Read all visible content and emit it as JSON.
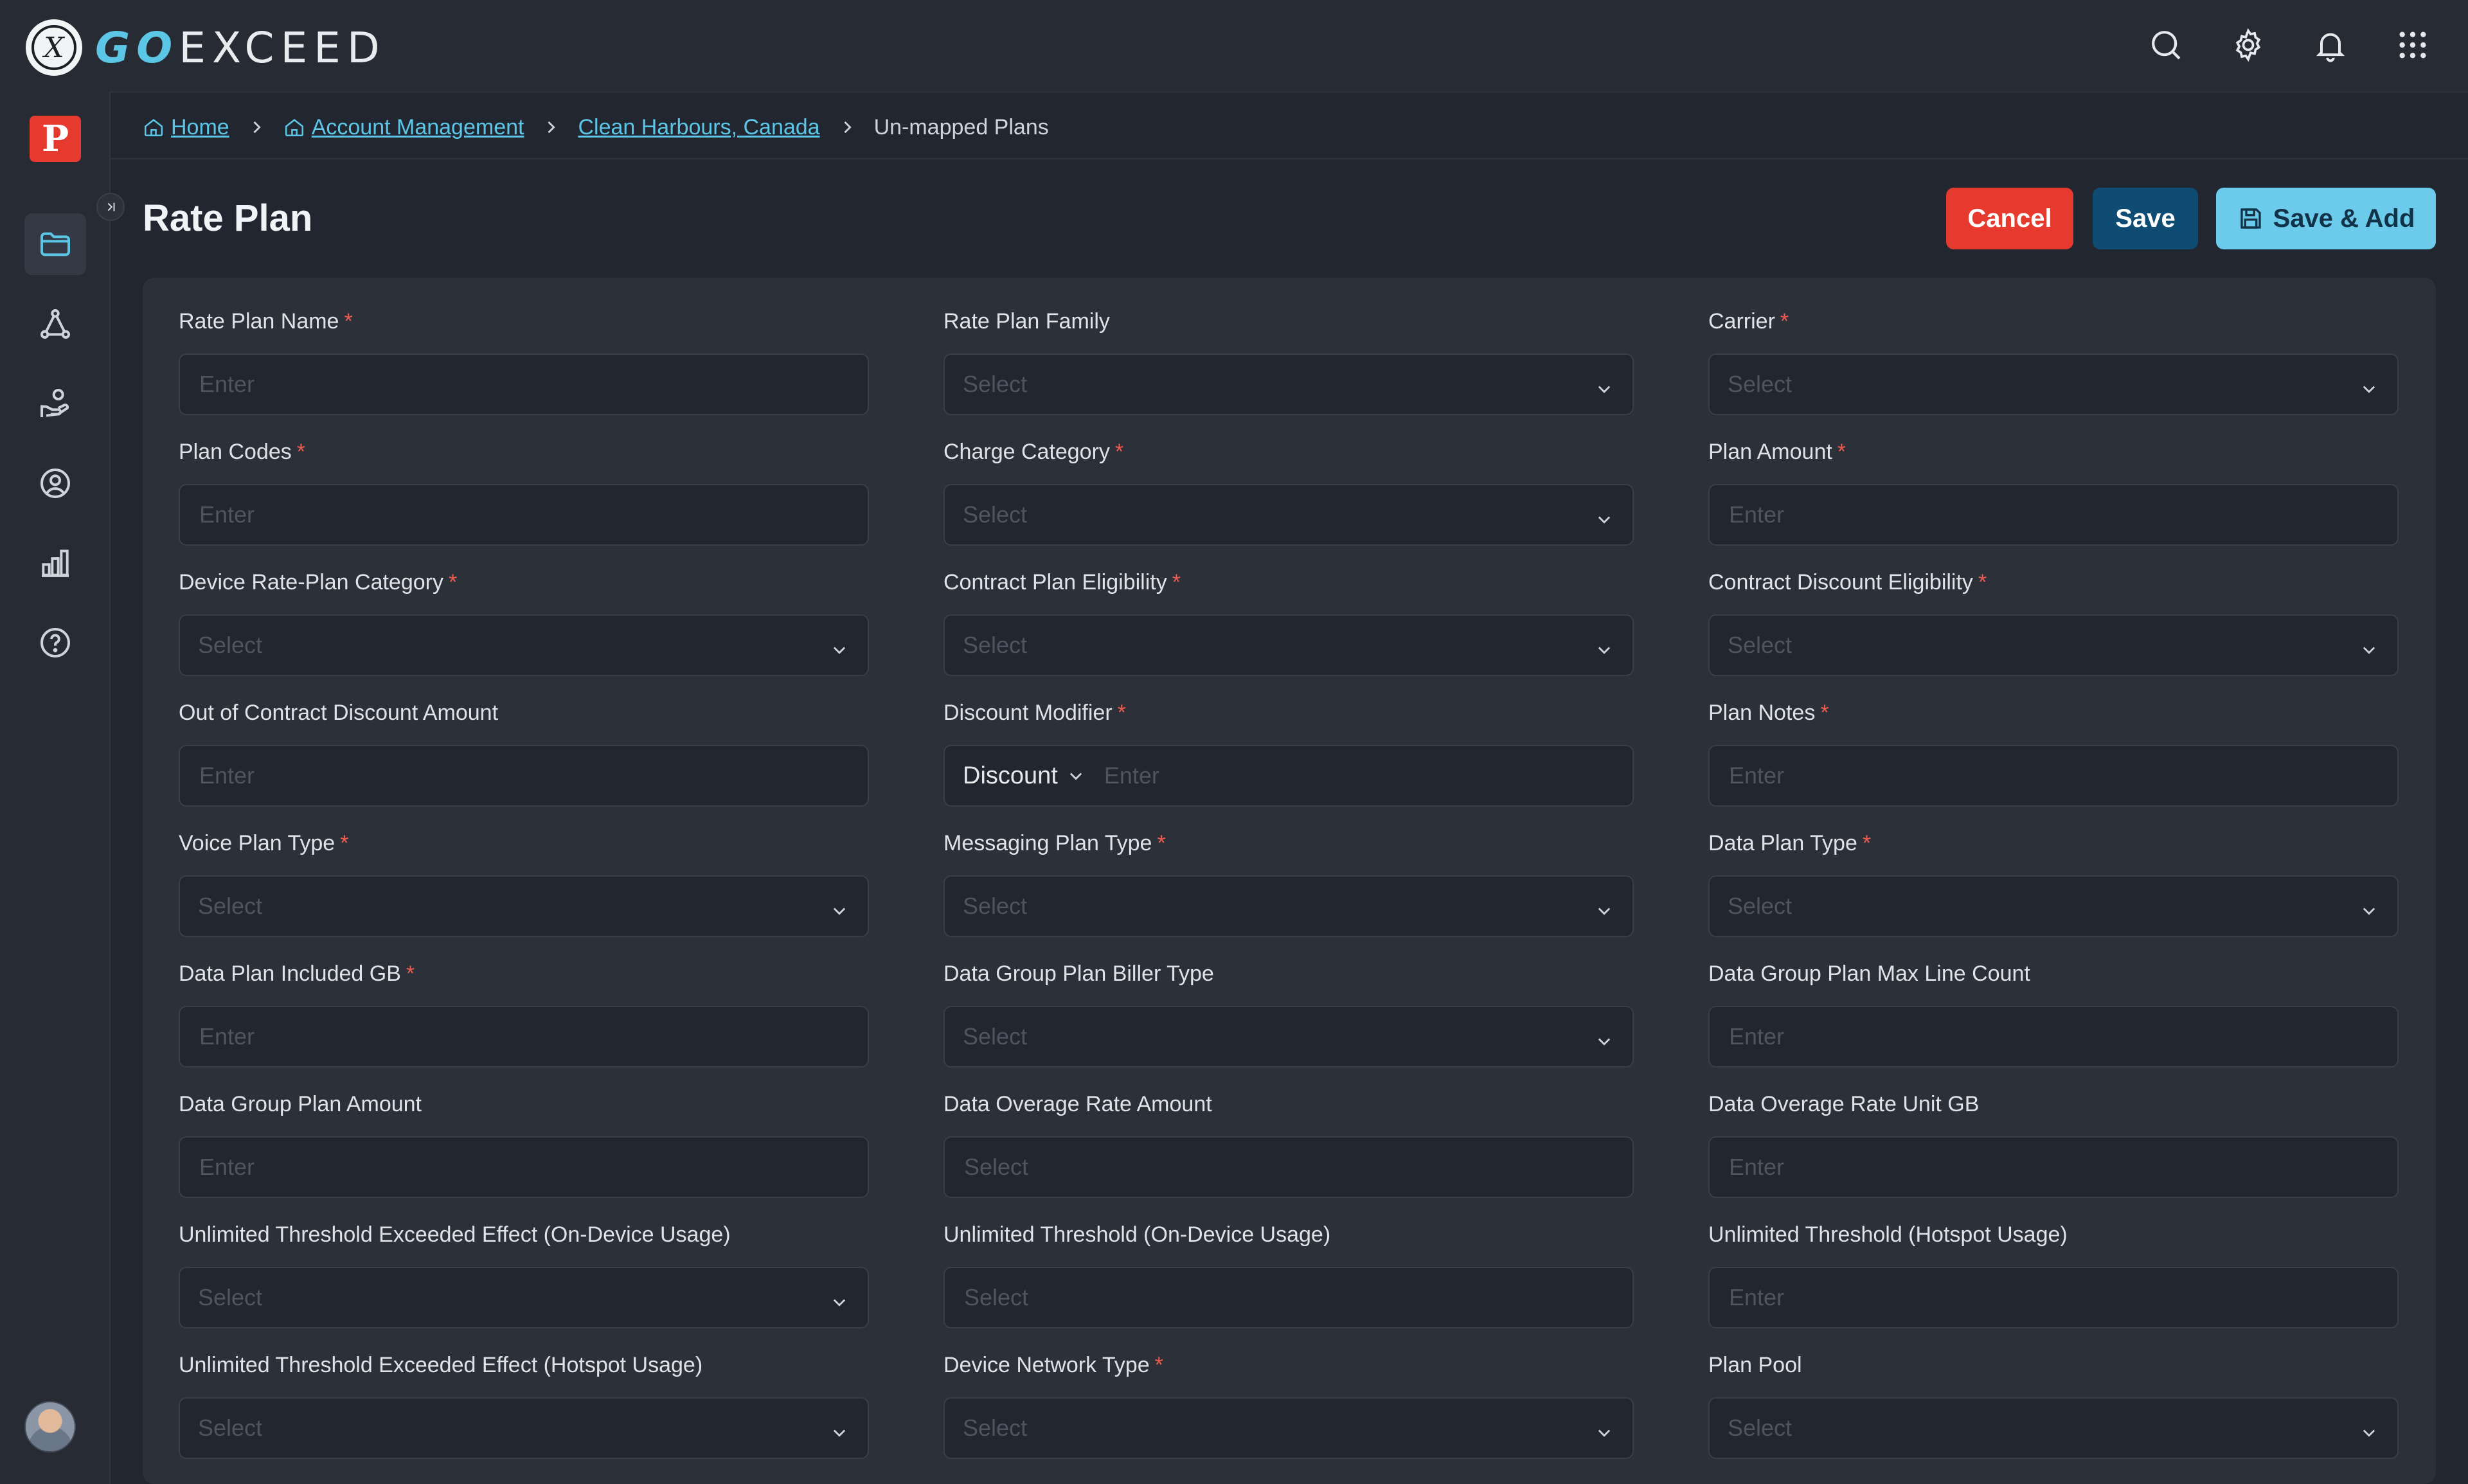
{
  "app": {
    "logo_letter": "X",
    "name_accent": "GO",
    "name_rest": "EXCEED",
    "brand_badge": "P"
  },
  "topbar": {
    "icons": [
      "search-icon",
      "settings-gear-icon",
      "notification-bell-icon",
      "apps-grid-icon"
    ]
  },
  "sidebar": {
    "items": [
      "folder-icon",
      "network-icon",
      "hand-coins-icon",
      "user-circle-icon",
      "bar-chart-icon",
      "help-circle-icon"
    ],
    "active_index": 0
  },
  "breadcrumb": {
    "items": [
      "Home",
      "Account Management",
      "Clean Harbours, Canada"
    ],
    "current": "Un-mapped Plans"
  },
  "page": {
    "title": "Rate Plan"
  },
  "actions": {
    "cancel": "Cancel",
    "save": "Save",
    "save_add": "Save & Add"
  },
  "form": {
    "required_mark": "*",
    "fields": [
      {
        "label": "Rate Plan Name",
        "required": true,
        "type": "input",
        "placeholder": "Enter"
      },
      {
        "label": "Rate Plan Family",
        "required": false,
        "type": "select",
        "placeholder": "Select"
      },
      {
        "label": "Carrier",
        "required": true,
        "type": "select",
        "placeholder": "Select"
      },
      {
        "label": "Plan Codes",
        "required": true,
        "type": "input",
        "placeholder": "Enter"
      },
      {
        "label": "Charge Category",
        "required": true,
        "type": "select",
        "placeholder": "Select"
      },
      {
        "label": "Plan Amount",
        "required": true,
        "type": "input",
        "placeholder": "Enter"
      },
      {
        "label": "Device Rate-Plan Category",
        "required": true,
        "type": "select",
        "placeholder": "Select"
      },
      {
        "label": "Contract Plan Eligibility",
        "required": true,
        "type": "select",
        "placeholder": "Select"
      },
      {
        "label": "Contract Discount Eligibility",
        "required": true,
        "type": "select",
        "placeholder": "Select"
      },
      {
        "label": "Out of Contract Discount Amount",
        "required": false,
        "type": "input",
        "placeholder": "Enter"
      },
      {
        "label": "Discount Modifier",
        "required": true,
        "type": "prefix-input",
        "prefix": "Discount",
        "placeholder": "Enter"
      },
      {
        "label": "Plan Notes",
        "required": true,
        "type": "input",
        "placeholder": "Enter"
      },
      {
        "label": "Voice Plan Type",
        "required": true,
        "type": "select",
        "placeholder": "Select"
      },
      {
        "label": "Messaging Plan Type",
        "required": true,
        "type": "select",
        "placeholder": "Select"
      },
      {
        "label": "Data Plan Type",
        "required": true,
        "type": "select",
        "placeholder": "Select"
      },
      {
        "label": "Data Plan Included GB",
        "required": true,
        "type": "input",
        "placeholder": "Enter"
      },
      {
        "label": "Data Group Plan Biller Type",
        "required": false,
        "type": "select",
        "placeholder": "Select"
      },
      {
        "label": "Data Group Plan Max Line Count",
        "required": false,
        "type": "input",
        "placeholder": "Enter"
      },
      {
        "label": "Data Group Plan Amount",
        "required": false,
        "type": "input",
        "placeholder": "Enter"
      },
      {
        "label": "Data Overage Rate Amount",
        "required": false,
        "type": "input",
        "placeholder": "Select"
      },
      {
        "label": "Data Overage Rate Unit GB",
        "required": false,
        "type": "input",
        "placeholder": "Enter"
      },
      {
        "label": "Unlimited Threshold Exceeded Effect (On-Device Usage)",
        "required": false,
        "type": "select",
        "placeholder": "Select"
      },
      {
        "label": "Unlimited Threshold (On-Device Usage)",
        "required": false,
        "type": "input",
        "placeholder": "Select"
      },
      {
        "label": "Unlimited Threshold (Hotspot Usage)",
        "required": false,
        "type": "input",
        "placeholder": "Enter"
      },
      {
        "label": "Unlimited Threshold Exceeded Effect (Hotspot Usage)",
        "required": false,
        "type": "select",
        "placeholder": "Select"
      },
      {
        "label": "Device Network Type",
        "required": true,
        "type": "select",
        "placeholder": "Select"
      },
      {
        "label": "Plan Pool",
        "required": false,
        "type": "select",
        "placeholder": "Select"
      }
    ]
  },
  "colors": {
    "accent": "#5cc6e6",
    "danger": "#e63a2e",
    "primary": "#0f4c74",
    "background": "#222630"
  }
}
